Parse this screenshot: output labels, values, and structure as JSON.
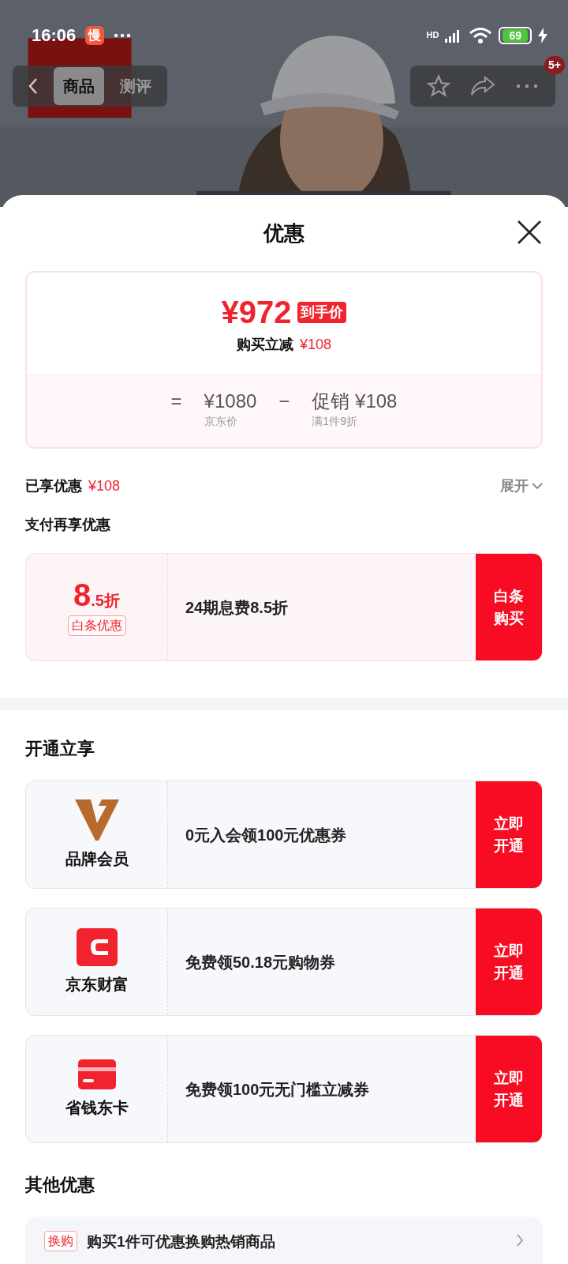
{
  "status_bar": {
    "time": "16:06",
    "app_badge": "慢",
    "network": "HD",
    "battery": "69"
  },
  "nav": {
    "tabs": [
      {
        "label": "商品",
        "selected": true
      },
      {
        "label": "测评",
        "selected": false
      }
    ],
    "badge": "5+"
  },
  "sheet": {
    "title": "优惠",
    "price_card": {
      "final_price": "¥972",
      "final_tag": "到手价",
      "reduce_label": "购买立减",
      "reduce_amount": "¥108",
      "equals": "=",
      "minus": "−",
      "base_price": "¥1080",
      "base_label": "京东价",
      "promo_price": "促销 ¥108",
      "promo_label": "满1件9折"
    },
    "enjoyed": {
      "label": "已享优惠",
      "amount": "¥108",
      "expand": "展开"
    },
    "pay_section": {
      "title": "支付再享优惠",
      "card": {
        "discount_big": "8",
        "discount_small": ".5折",
        "tag": "白条优惠",
        "text": "24期息费8.5折",
        "button": "白条购买"
      }
    },
    "open_section": {
      "title": "开通立享",
      "items": [
        {
          "kind": "brand",
          "name": "品牌会员",
          "text": "0元入会领100元优惠券",
          "button": "立即开通"
        },
        {
          "kind": "wallet",
          "name": "京东财富",
          "text": "免费领50.18元购物券",
          "button": "立即开通"
        },
        {
          "kind": "card",
          "name": "省钱东卡",
          "text": "免费领100元无门槛立减券",
          "button": "立即开通"
        }
      ]
    },
    "other_section": {
      "title": "其他优惠",
      "items": [
        {
          "tag": "换购",
          "text": "购买1件可优惠换购热销商品"
        }
      ]
    }
  }
}
